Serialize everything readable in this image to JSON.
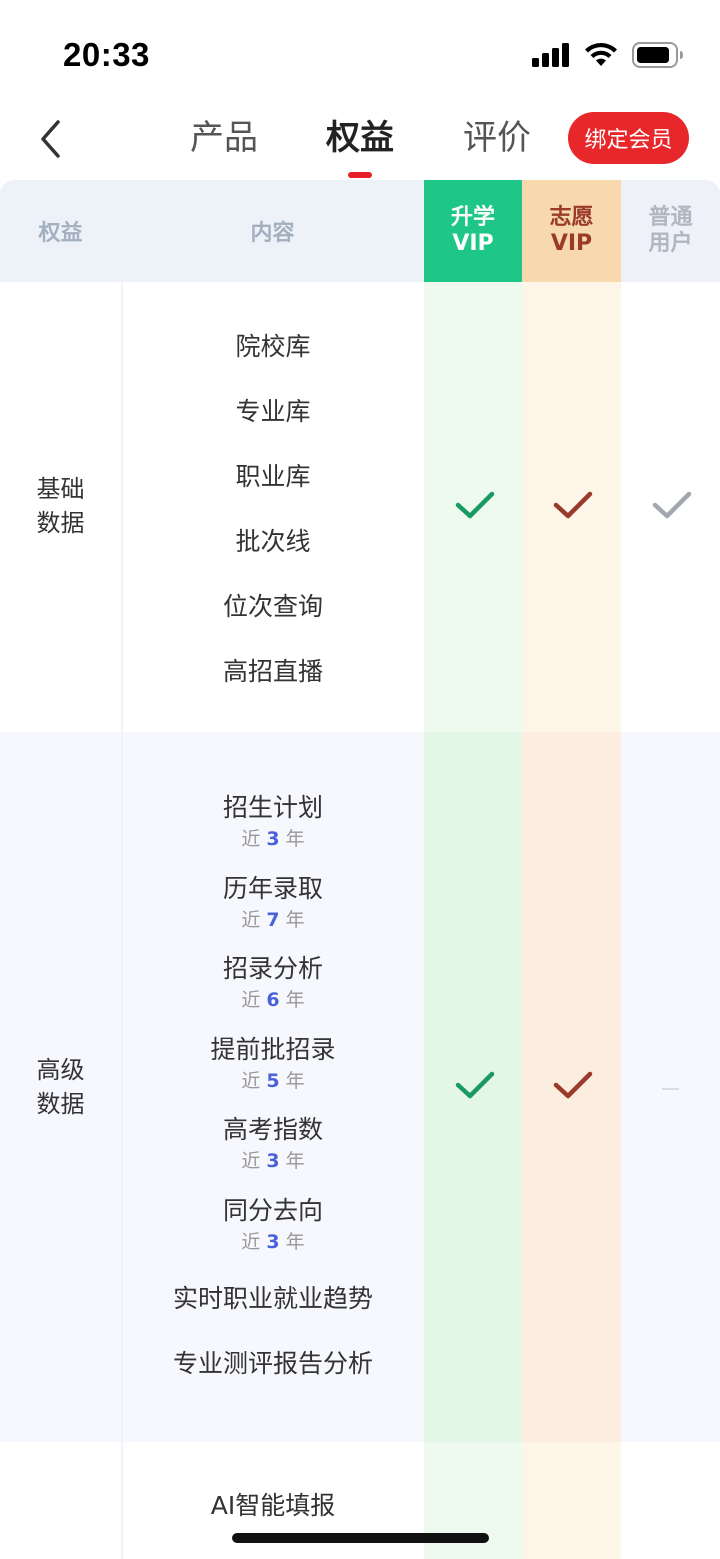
{
  "status": {
    "time": "20:33"
  },
  "nav": {
    "tabs": [
      {
        "label": "产品"
      },
      {
        "label": "权益"
      },
      {
        "label": "评价"
      }
    ],
    "active_tab": "权益",
    "bind_button": "绑定会员"
  },
  "table": {
    "headers": {
      "quanyi": "权益",
      "content": "内容",
      "sx_line1": "升学",
      "sx_line2": "VIP",
      "zy_line1": "志愿",
      "zy_line2": "VIP",
      "pt_line1": "普通",
      "pt_line2": "用户"
    },
    "sections": [
      {
        "label_line1": "基础",
        "label_line2": "数据",
        "items": [
          "院校库",
          "专业库",
          "职业库",
          "批次线",
          "位次查询",
          "高招直播"
        ]
      },
      {
        "label_line1": "高级",
        "label_line2": "数据",
        "items": [
          {
            "name": "招生计划",
            "prefix": "近",
            "years": "3",
            "suffix": "年"
          },
          {
            "name": "历年录取",
            "prefix": "近",
            "years": "7",
            "suffix": "年"
          },
          {
            "name": "招录分析",
            "prefix": "近",
            "years": "6",
            "suffix": "年"
          },
          {
            "name": "提前批招录",
            "prefix": "近",
            "years": "5",
            "suffix": "年"
          },
          {
            "name": "高考指数",
            "prefix": "近",
            "years": "3",
            "suffix": "年"
          },
          {
            "name": "同分去向",
            "prefix": "近",
            "years": "3",
            "suffix": "年"
          },
          {
            "name": "实时职业就业趋势"
          },
          {
            "name": "专业测评报告分析"
          }
        ]
      },
      {
        "items": [
          "AI智能填报"
        ]
      }
    ]
  },
  "colors": {
    "accent_red": "#e8272b",
    "sx_green": "#1ec788",
    "zy_gold": "#f7d9ad",
    "check_green": "#1a9a63",
    "check_brown": "#9a3a2a",
    "check_gray": "#a3a8b0"
  },
  "icons": [
    "back-chevron-icon",
    "signal-icon",
    "wifi-icon",
    "battery-icon",
    "check-icon",
    "dash-icon"
  ]
}
